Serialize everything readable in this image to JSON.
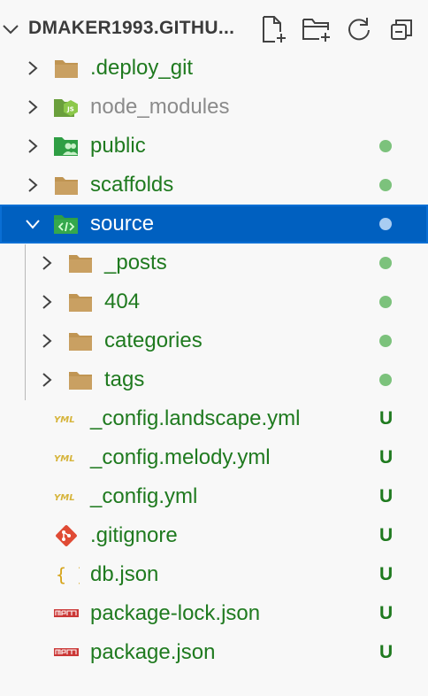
{
  "explorer": {
    "title": "DMAKER1993.GITHU...",
    "actions": [
      "new-file-icon",
      "new-folder-icon",
      "refresh-icon",
      "collapse-all-icon"
    ]
  },
  "colors": {
    "git_green": "#1f7a1f",
    "ignored_gray": "#8b8b8b",
    "dot_green": "#7cc27c",
    "selected_bg": "#0060c0",
    "folder": "#c09553"
  },
  "tree": [
    {
      "label": ".deploy_git",
      "icon": "folder-icon",
      "status": ""
    },
    {
      "label": "node_modules",
      "icon": "node-folder-icon",
      "status": ""
    },
    {
      "label": "public",
      "icon": "public-folder-icon",
      "status": "dot"
    },
    {
      "label": "scaffolds",
      "icon": "folder-icon",
      "status": "dot"
    },
    {
      "label": "source",
      "icon": "source-folder-icon",
      "status": "dot",
      "expanded": true
    },
    {
      "label": "_posts",
      "icon": "folder-icon",
      "status": "dot"
    },
    {
      "label": "404",
      "icon": "folder-icon",
      "status": "dot"
    },
    {
      "label": "categories",
      "icon": "folder-icon",
      "status": "dot"
    },
    {
      "label": "tags",
      "icon": "folder-icon",
      "status": "dot"
    },
    {
      "label": "_config.landscape.yml",
      "icon": "yaml-icon",
      "status": "U"
    },
    {
      "label": "_config.melody.yml",
      "icon": "yaml-icon",
      "status": "U"
    },
    {
      "label": "_config.yml",
      "icon": "yaml-icon",
      "status": "U"
    },
    {
      "label": ".gitignore",
      "icon": "git-icon",
      "status": "U"
    },
    {
      "label": "db.json",
      "icon": "json-icon",
      "status": "U"
    },
    {
      "label": "package-lock.json",
      "icon": "npm-icon",
      "status": "U"
    },
    {
      "label": "package.json",
      "icon": "npm-icon",
      "status": "U"
    }
  ]
}
